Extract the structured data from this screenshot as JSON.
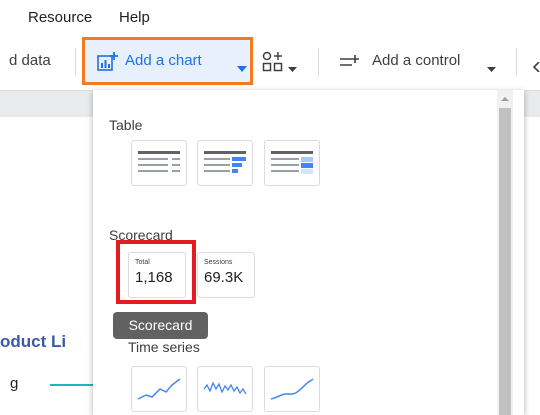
{
  "menubar": {
    "items": [
      "Resource",
      "Help"
    ]
  },
  "toolbar": {
    "add_data_label": "d data",
    "add_chart_label": "Add a chart",
    "add_control_label": "Add a control"
  },
  "canvas": {
    "heading_fragment": "oduct Li",
    "legend_label": "g"
  },
  "dropdown": {
    "sections": {
      "table": {
        "label": "Table"
      },
      "scorecard": {
        "label": "Scorecard",
        "items": [
          {
            "title": "Total",
            "value": "1,168"
          },
          {
            "title": "Sessions",
            "value": "69.3K"
          }
        ]
      },
      "time_series": {
        "label": "Time series"
      }
    },
    "tooltip": "Scorecard"
  },
  "colors": {
    "highlight_orange": "#f7791f",
    "highlight_red": "#e31b23",
    "accent_blue": "#1a73e8"
  },
  "icons": [
    "add-chart-icon",
    "dropdown-arrow-icon",
    "add-component-icon",
    "add-control-icon",
    "chevron-left-icon"
  ]
}
